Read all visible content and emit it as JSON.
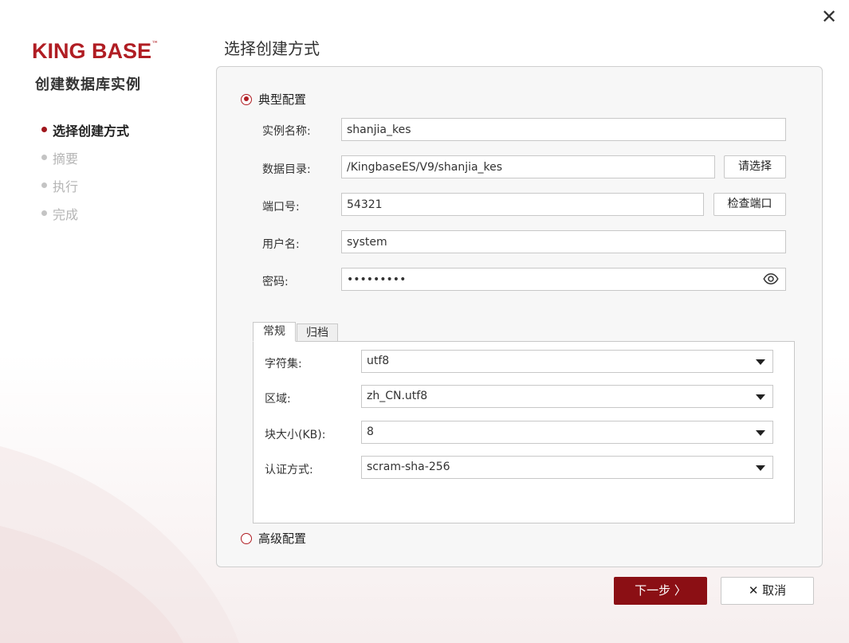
{
  "window": {
    "close_icon": "close-icon"
  },
  "brand": {
    "logo_text": "KING BASE",
    "logo_tm": "™",
    "logo_color": "#b01d23",
    "subtitle": "创建数据库实例"
  },
  "steps": [
    {
      "label": "选择创建方式",
      "active": true
    },
    {
      "label": "摘要",
      "active": false
    },
    {
      "label": "执行",
      "active": false
    },
    {
      "label": "完成",
      "active": false
    }
  ],
  "page_title": "选择创建方式",
  "typical": {
    "radio_label": "典型配置",
    "selected": true,
    "fields": {
      "instance_name": {
        "label": "实例名称:",
        "value": "shanjia_kes"
      },
      "data_dir": {
        "label": "数据目录:",
        "value": "/KingbaseES/V9/shanjia_kes",
        "button": "请选择"
      },
      "port": {
        "label": "端口号:",
        "value": "54321",
        "button": "检查端口"
      },
      "username": {
        "label": "用户名:",
        "value": "system"
      },
      "password": {
        "label": "密码:",
        "value": "•••••••••",
        "icon": "eye-icon"
      }
    },
    "tabs": [
      {
        "label": "常规",
        "active": true
      },
      {
        "label": "归档",
        "active": false
      }
    ],
    "general": {
      "charset": {
        "label": "字符集:",
        "value": "utf8"
      },
      "locale": {
        "label": "区域:",
        "value": "zh_CN.utf8"
      },
      "block_size": {
        "label": "块大小(KB):",
        "value": "8"
      },
      "auth": {
        "label": "认证方式:",
        "value": "scram-sha-256"
      }
    }
  },
  "advanced": {
    "radio_label": "高级配置",
    "selected": false
  },
  "footer": {
    "next_label": "下一步 〉",
    "cancel_label": "✕ 取消",
    "primary_color": "#8b0f14"
  }
}
